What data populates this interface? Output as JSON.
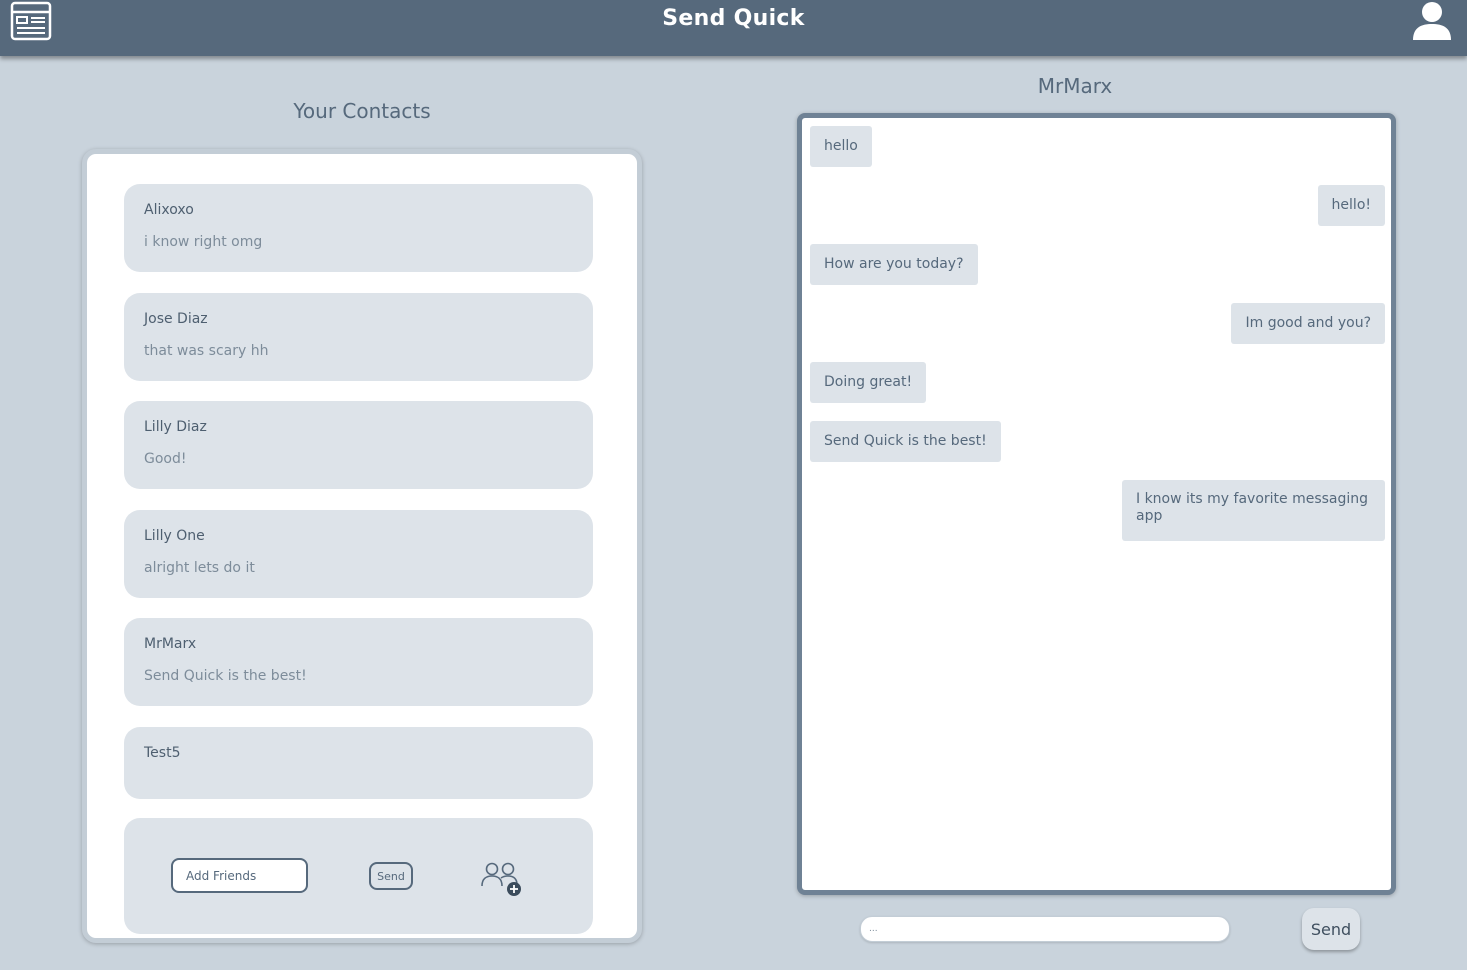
{
  "header": {
    "title": "Send Quick",
    "menu_icon": "menu-icon",
    "user_icon": "user-icon",
    "bar_color": "#56697c"
  },
  "contacts": {
    "heading": "Your Contacts",
    "items": [
      {
        "name": "Alixoxo",
        "last_message": "i know right omg"
      },
      {
        "name": "Jose Diaz",
        "last_message": "that was scary hh"
      },
      {
        "name": "Lilly Diaz",
        "last_message": "Good!"
      },
      {
        "name": "Lilly One",
        "last_message": "alright lets do it"
      },
      {
        "name": "MrMarx",
        "last_message": "Send Quick is the best!"
      },
      {
        "name": "Test5",
        "last_message": ""
      }
    ],
    "add_friends": {
      "placeholder": "Add Friends",
      "send_label": "Send",
      "icon": "add-friends-icon"
    }
  },
  "chat": {
    "contact_name": "MrMarx",
    "messages": [
      {
        "direction": "in",
        "text": "hello"
      },
      {
        "direction": "out",
        "text": "hello!"
      },
      {
        "direction": "in",
        "text": "How are you today?"
      },
      {
        "direction": "out",
        "text": "Im good and you?"
      },
      {
        "direction": "in",
        "text": "Doing great!"
      },
      {
        "direction": "in",
        "text": "Send Quick is the best!"
      },
      {
        "direction": "out",
        "text": "I know its my favorite messaging app"
      }
    ],
    "input_placeholder": "...",
    "send_label": "Send"
  }
}
